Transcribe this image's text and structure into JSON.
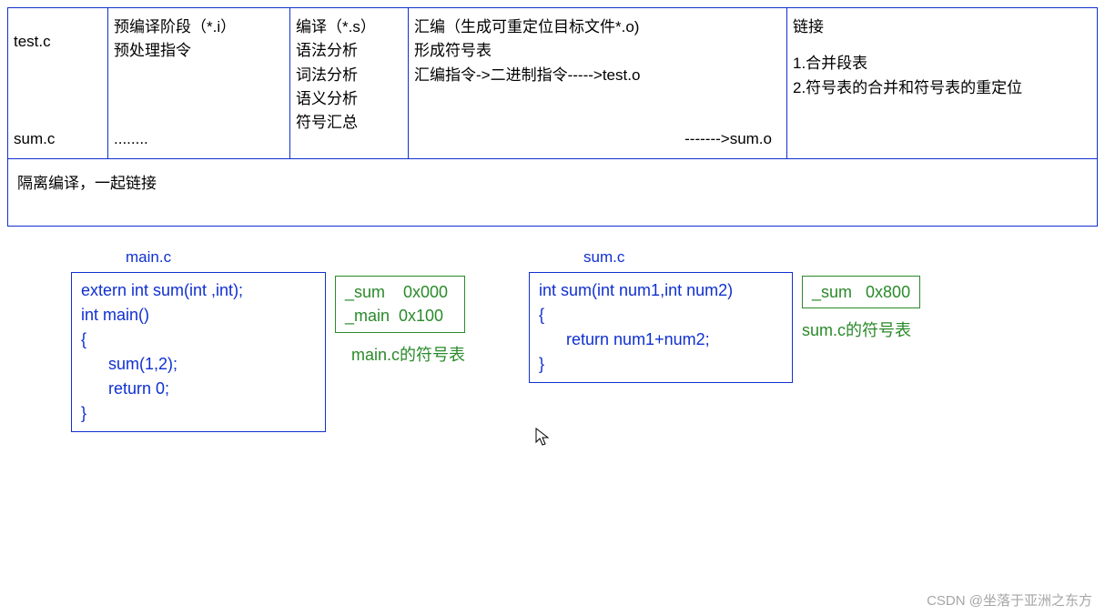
{
  "table": {
    "row1": {
      "c0": "test.c",
      "c1_l1": "预编译阶段（*.i）",
      "c1_l2": "预处理指令",
      "c2_l1": "编译（*.s）",
      "c2_l2": "语法分析",
      "c2_l3": "词法分析",
      "c2_l4": "语义分析",
      "c2_l5": "符号汇总",
      "c3_l1": "汇编（生成可重定位目标文件*.o)",
      "c3_l2": " 形成符号表",
      "c3_l3": " 汇编指令->二进制指令----->test.o",
      "c4_l1": "链接",
      "c4_l2": "1.合并段表",
      "c4_l3": "2.符号表的合并和符号表的重定位"
    },
    "row2": {
      "c0": "sum.c",
      "c1": "........",
      "c3": "------->sum.o"
    },
    "footer": "隔离编译，一起链接"
  },
  "lower": {
    "main_title": "main.c",
    "main_code": "extern int sum(int ,int);\nint main()\n{\n      sum(1,2);\n      return 0;\n}",
    "main_sym": "_sum    0x000\n_main  0x100",
    "main_sym_caption": "main.c的符号表",
    "sum_title": "sum.c",
    "sum_code": "int sum(int num1,int num2)\n{\n      return num1+num2;\n}",
    "sum_sym": "_sum   0x800",
    "sum_sym_caption": "sum.c的符号表"
  },
  "watermark": "CSDN @坐落于亚洲之东方"
}
